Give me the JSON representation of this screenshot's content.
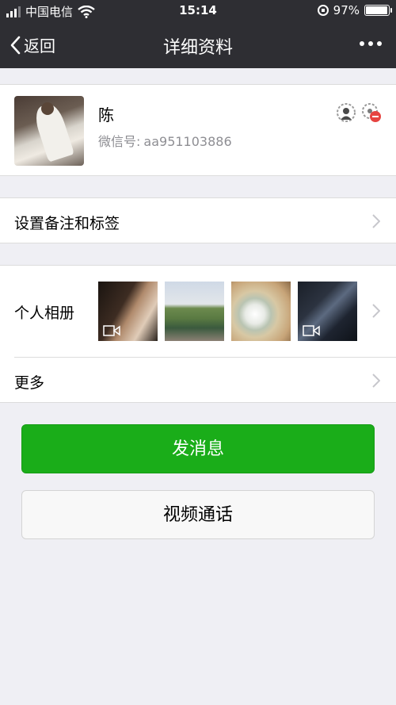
{
  "status_bar": {
    "carrier": "中国电信",
    "time": "15:14",
    "battery_percent": "97%",
    "battery_level": 0.97,
    "icons": [
      "signal-icon",
      "wifi-icon",
      "rotation-lock-icon",
      "battery-icon"
    ]
  },
  "nav": {
    "back_label": "返回",
    "title": "详细资料",
    "more_icon": "more-dots-icon"
  },
  "profile": {
    "name": "陈",
    "wechat_id_label": "微信号:",
    "wechat_id": "aa951103886",
    "icons": [
      "friend-circle-icon",
      "blocked-friend-icon"
    ]
  },
  "rows": {
    "remark_label": "设置备注和标签",
    "album_label": "个人相册",
    "more_label": "更多"
  },
  "album": {
    "thumbnails": [
      {
        "name": "album-photo-1",
        "video": true
      },
      {
        "name": "album-photo-2",
        "video": false
      },
      {
        "name": "album-photo-3",
        "video": false
      },
      {
        "name": "album-photo-4",
        "video": true
      }
    ]
  },
  "buttons": {
    "send_message": "发消息",
    "video_call": "视频通话"
  },
  "colors": {
    "nav_bg": "#2e2e33",
    "page_bg": "#efeff4",
    "primary_green": "#1aad19",
    "secondary_text": "#8e8e93",
    "delete_red": "#e64340"
  }
}
